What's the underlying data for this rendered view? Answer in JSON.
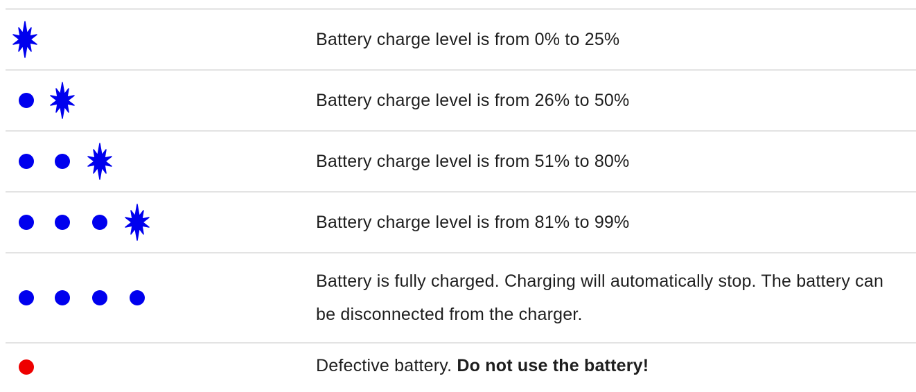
{
  "colors": {
    "indicator_blue": "#0000ee",
    "indicator_red": "#ee0000",
    "divider": "#e3e3e3",
    "text": "#1e1e1e"
  },
  "rows": [
    {
      "indicator": [
        "flashing-star"
      ],
      "description": "Battery charge level is from 0% to 25%"
    },
    {
      "indicator": [
        "solid-dot",
        "flashing-star"
      ],
      "description": "Battery charge level is from 26% to 50%"
    },
    {
      "indicator": [
        "solid-dot",
        "solid-dot",
        "flashing-star"
      ],
      "description": "Battery charge level is from 51% to 80%"
    },
    {
      "indicator": [
        "solid-dot",
        "solid-dot",
        "solid-dot",
        "flashing-star"
      ],
      "description": "Battery charge level is from 81% to 99%"
    },
    {
      "indicator": [
        "solid-dot",
        "solid-dot",
        "solid-dot",
        "solid-dot"
      ],
      "description": "Battery is fully charged. Charging will automatically stop. The battery can be disconnected from the charger."
    },
    {
      "indicator": [
        "red-dot"
      ],
      "description_plain": "Defective battery. ",
      "description_bold": "Do not use the battery!"
    }
  ]
}
